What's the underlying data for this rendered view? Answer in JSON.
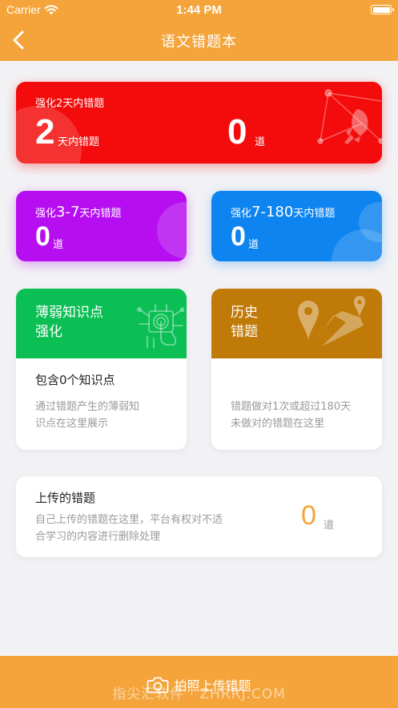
{
  "status_bar": {
    "carrier": "Carrier",
    "time": "1:44 PM"
  },
  "nav": {
    "title": "语文错题本"
  },
  "cards": {
    "recent2": {
      "label": "强化2天内错题",
      "count": "2",
      "count_suffix": "天内错题",
      "value": "0",
      "unit": "道",
      "color": "#f40b0b"
    },
    "range3_7": {
      "label_prefix": "强化",
      "label_range": "3-7",
      "label_suffix": "天内错题",
      "value": "0",
      "unit": "道",
      "color": "#b60ef0"
    },
    "range7_180": {
      "label_prefix": "强化",
      "label_range": "7-180",
      "label_suffix": "天内错题",
      "value": "0",
      "unit": "道",
      "color": "#0d84ef"
    }
  },
  "weak_points": {
    "title_line1": "薄弱知识点",
    "title_line2": "强化",
    "subtitle": "包含0个知识点",
    "desc_line1": "通过错题产生的薄弱知",
    "desc_line2": "识点在这里展示",
    "color": "#0bbf55"
  },
  "history": {
    "title_line1": "历史",
    "title_line2": "错题",
    "desc_line1": "错题做对1次或超过180天",
    "desc_line2": "未做对的错题在这里",
    "color": "#c07a08"
  },
  "uploaded": {
    "title": "上传的错题",
    "desc_line1": "自己上传的错题在这里，平台有权对不适",
    "desc_line2": "合学习的内容进行删除处理",
    "value": "0",
    "unit": "道"
  },
  "bottom_bar": {
    "label": "拍照上传错题",
    "watermark": "指尖汇软件 · ZHRRJ.COM"
  },
  "icons": [
    "wifi-icon",
    "battery-icon",
    "back-chevron-icon",
    "rocket-icon",
    "touch-chip-icon",
    "map-pin-icon",
    "camera-icon"
  ],
  "accent": "#f4a43a"
}
